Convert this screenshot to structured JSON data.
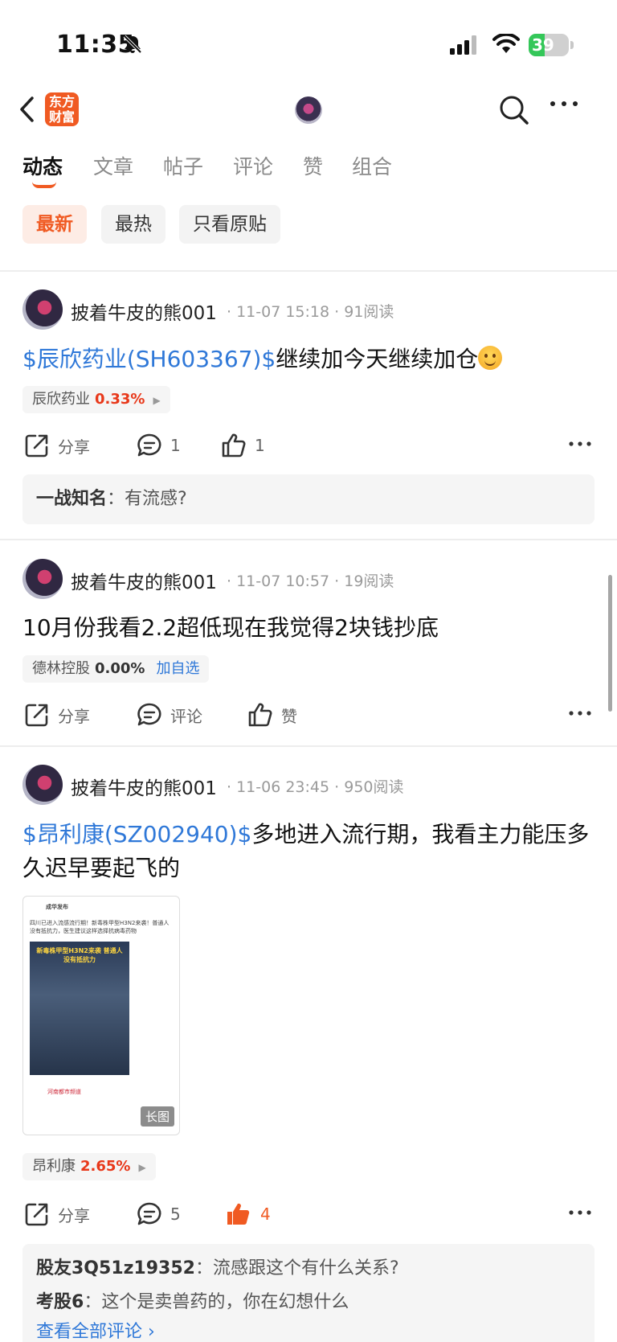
{
  "status_bar": {
    "time": "11:35",
    "battery": "39",
    "battery_level": 0.39
  },
  "header": {
    "logo_line1": "东方",
    "logo_line2": "财富"
  },
  "tabs": [
    {
      "label": "动态",
      "active": true
    },
    {
      "label": "文章"
    },
    {
      "label": "帖子"
    },
    {
      "label": "评论"
    },
    {
      "label": "赞"
    },
    {
      "label": "组合"
    }
  ],
  "filters": [
    {
      "label": "最新",
      "active": true
    },
    {
      "label": "最热"
    },
    {
      "label": "只看原贴"
    }
  ],
  "colors": {
    "accent": "#f05a22",
    "link": "#2f78d8",
    "up": "#e8381a"
  },
  "posts": [
    {
      "author": "披着牛皮的熊001",
      "datetime": "11-07 15:18",
      "reads": "91阅读",
      "stock_tag": "$辰欣药业(SH603367)$",
      "text": "继续加今天继续加仓",
      "stock_name": "辰欣药业",
      "stock_pct": "0.33%",
      "share_label": "分享",
      "comment_count": "1",
      "like_count": "1",
      "comments": [
        {
          "user": "一战知名",
          "text": "有流感?"
        }
      ]
    },
    {
      "author": "披着牛皮的熊001",
      "datetime": "11-07 10:57",
      "reads": "19阅读",
      "text": "10月份我看2.2超低现在我觉得2块钱抄底",
      "stock_name": "德林控股",
      "stock_pct": "0.00%",
      "add_label": "加自选",
      "share_label": "分享",
      "comment_label": "评论",
      "like_label": "赞"
    },
    {
      "author": "披着牛皮的熊001",
      "datetime": "11-06 23:45",
      "reads": "950阅读",
      "stock_tag": "$昂利康(SZ002940)$",
      "text": "多地进入流行期，我看主力能压多久迟早要起飞的",
      "image_badge": "长图",
      "thumb_title": "成华发布",
      "thumb_body": "四川已进入流感流行期！新毒株甲型H3N2来袭！普通人没有抵抗力，医生建议这样选择抗病毒药物",
      "thumb_caption": "新毒株甲型H3N2来袭 普通人没有抵抗力",
      "thumb_source": "河南都市频道",
      "stock_name": "昂利康",
      "stock_pct": "2.65%",
      "share_label": "分享",
      "comment_count": "5",
      "like_count": "4",
      "comments": [
        {
          "user": "股友3Q51z19352",
          "text": "流感跟这个有什么关系?"
        },
        {
          "user": "考股6",
          "text": "这个是卖兽药的，你在幻想什么"
        }
      ],
      "view_all": "查看全部评论 ›"
    }
  ]
}
